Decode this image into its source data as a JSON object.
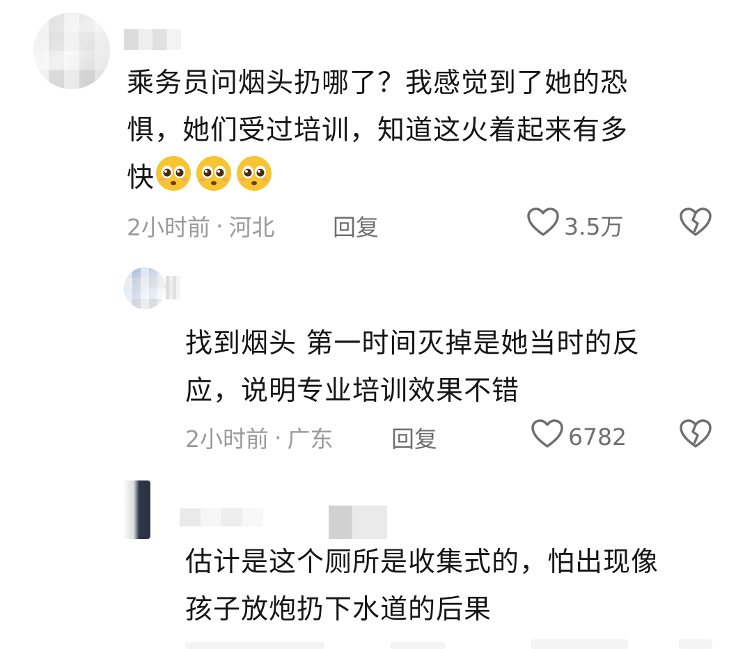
{
  "comments": [
    {
      "text_lines": [
        "乘务员问烟头扔哪了？我感觉到了她的恐",
        "惧，她们受过培训，知道这火着起来有多",
        "快"
      ],
      "emoji_count": 3,
      "emoji_icon": "pleading-face-icon",
      "time": "2小时前",
      "location": "河北",
      "reply_label": "回复",
      "likes": "3.5万"
    },
    {
      "text_lines": [
        "找到烟头 第一时间灭掉是她当时的反",
        "应，说明专业培训效果不错"
      ],
      "time": "2小时前",
      "location": "广东",
      "reply_label": "回复",
      "likes": "6782"
    },
    {
      "text_lines": [
        "估计是这个厕所是收集式的，怕出现像",
        "孩子放炮扔下水道的后果"
      ]
    }
  ],
  "colors": {
    "text": "#151515",
    "meta": "#9a9a9a",
    "action": "#6f6f6f",
    "emoji": "#f7c531"
  }
}
